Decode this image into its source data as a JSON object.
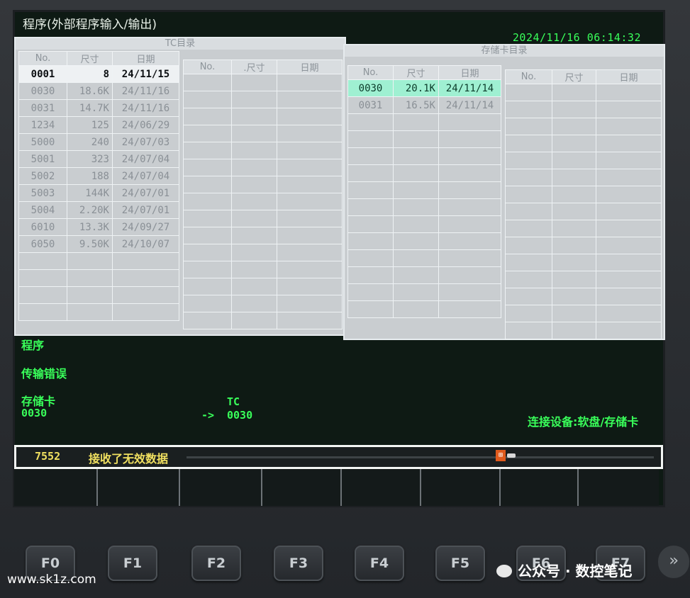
{
  "window": {
    "title": "程序(外部程序输入/输出)",
    "clock": "2024/11/16 06:14:32"
  },
  "tc_panel": {
    "title": "TC目录",
    "headers": [
      "No.",
      "尺寸",
      "日期"
    ],
    "headers_right": [
      "No.",
      ".尺寸",
      "日期"
    ],
    "rows": [
      {
        "no": "0001",
        "size": "8",
        "date": "24/11/15"
      },
      {
        "no": "0030",
        "size": "18.6K",
        "date": "24/11/16"
      },
      {
        "no": "0031",
        "size": "14.7K",
        "date": "24/11/16"
      },
      {
        "no": "1234",
        "size": "125",
        "date": "24/06/29"
      },
      {
        "no": "5000",
        "size": "240",
        "date": "24/07/03"
      },
      {
        "no": "5001",
        "size": "323",
        "date": "24/07/04"
      },
      {
        "no": "5002",
        "size": "188",
        "date": "24/07/04"
      },
      {
        "no": "5003",
        "size": "144K",
        "date": "24/07/01"
      },
      {
        "no": "5004",
        "size": "2.20K",
        "date": "24/07/01"
      },
      {
        "no": "6010",
        "size": "13.3K",
        "date": "24/09/27"
      },
      {
        "no": "6050",
        "size": "9.50K",
        "date": "24/10/07"
      }
    ]
  },
  "card_panel": {
    "title": "存储卡目录",
    "headers": [
      "No.",
      "尺寸",
      "日期"
    ],
    "headers_right": [
      "No.",
      "尺寸",
      "日期"
    ],
    "rows": [
      {
        "no": "0030",
        "size": "20.1K",
        "date": "24/11/14"
      },
      {
        "no": "0031",
        "size": "16.5K",
        "date": "24/11/14"
      }
    ]
  },
  "messages": {
    "mode": "程序",
    "status": "传输错误",
    "source_label": "存储卡",
    "source_no": "0030",
    "arrow": "->",
    "dest_label": "TC",
    "dest_no": "0030",
    "connect": "连接设备:软盘/存储卡"
  },
  "alarm": {
    "code": "7552",
    "text": "接收了无效数据",
    "icon": "card-error-icon"
  },
  "function_keys": [
    "F0",
    "F1",
    "F2",
    "F3",
    "F4",
    "F5",
    "F6",
    "F7"
  ],
  "next_key": "»",
  "footer": {
    "url": "www.sk1z.com",
    "watermark": "公众号 · 数控笔记"
  }
}
